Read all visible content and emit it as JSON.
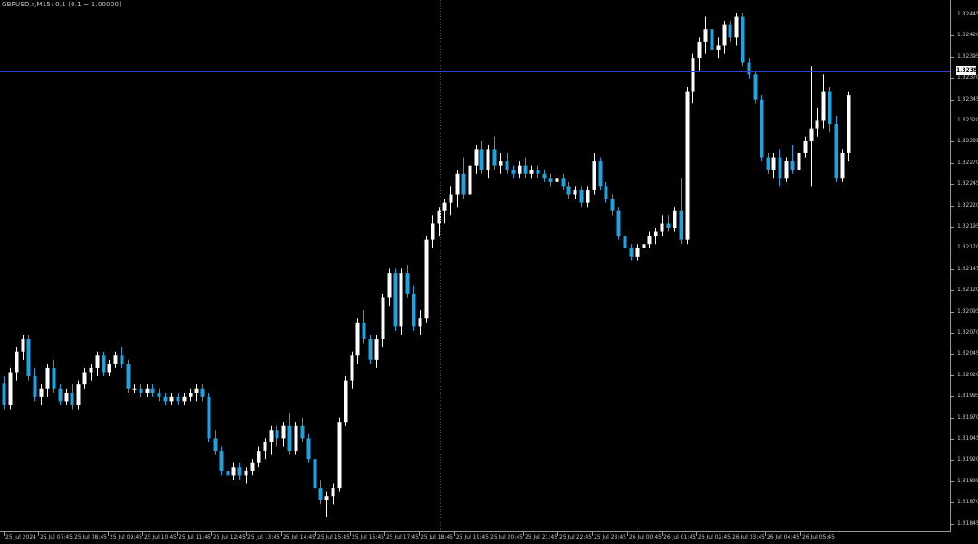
{
  "header": {
    "symbol_label": "GBPUSD.r,M15: 0.1 (0.1 ~ 1.00000)"
  },
  "price_axis": {
    "labels": [
      "1.32445",
      "1.32420",
      "1.32395",
      "1.32370",
      "1.32345",
      "1.32320",
      "1.32295",
      "1.32270",
      "1.32245",
      "1.32220",
      "1.32195",
      "1.32170",
      "1.32145",
      "1.32120",
      "1.32095",
      "1.32070",
      "1.32045",
      "1.32020",
      "1.31995",
      "1.31970",
      "1.31945",
      "1.31920",
      "1.31895",
      "1.31870",
      "1.31845"
    ],
    "current_price": "1.32380"
  },
  "time_axis": {
    "labels": [
      "25 Jul 2024",
      "25 Jul 07:45",
      "25 Jul 08:45",
      "25 Jul 09:45",
      "25 Jul 10:45",
      "25 Jul 11:45",
      "25 Jul 12:45",
      "25 Jul 13:45",
      "25 Jul 14:45",
      "25 Jul 15:45",
      "25 Jul 16:45",
      "25 Jul 17:45",
      "25 Jul 18:45",
      "25 Jul 19:45",
      "25 Jul 20:45",
      "25 Jul 21:45",
      "25 Jul 22:45",
      "25 Jul 23:45",
      "26 Jul 00:45",
      "26 Jul 01:45",
      "26 Jul 02:45",
      "26 Jul 03:45",
      "26 Jul 04:45",
      "26 Jul 05:45"
    ]
  },
  "colors": {
    "background": "#000000",
    "bull": "#ffffff",
    "bear": "#1fa3e0",
    "crosshair": "#2b3fcf",
    "axis": "#9a9a9a",
    "text": "#c8c8c8"
  },
  "chart_data": {
    "type": "candlestick",
    "title": "GBPUSD.r,M15",
    "ylim": [
      1.3184,
      1.3245
    ],
    "crosshair_price": 1.3238,
    "candles": [
      [
        1.32002,
        1.3201,
        1.3197,
        1.31975
      ],
      [
        1.31975,
        1.3202,
        1.3197,
        1.32015
      ],
      [
        1.32015,
        1.32045,
        1.32005,
        1.3204
      ],
      [
        1.3204,
        1.3206,
        1.3203,
        1.32055
      ],
      [
        1.32055,
        1.3206,
        1.32005,
        1.3201
      ],
      [
        1.3201,
        1.3202,
        1.3198,
        1.31985
      ],
      [
        1.31985,
        1.32,
        1.31975,
        1.31995
      ],
      [
        1.31995,
        1.32025,
        1.31985,
        1.3202
      ],
      [
        1.3202,
        1.3203,
        1.3199,
        1.31995
      ],
      [
        1.31995,
        1.32,
        1.31975,
        1.3198
      ],
      [
        1.3198,
        1.31995,
        1.31975,
        1.3199
      ],
      [
        1.3199,
        1.32,
        1.3197,
        1.31975
      ],
      [
        1.31975,
        1.32005,
        1.3197,
        1.32
      ],
      [
        1.32,
        1.3202,
        1.31995,
        1.32015
      ],
      [
        1.32015,
        1.32025,
        1.32005,
        1.3202
      ],
      [
        1.3202,
        1.3204,
        1.3201,
        1.32035
      ],
      [
        1.32035,
        1.3204,
        1.3201,
        1.32015
      ],
      [
        1.32015,
        1.3203,
        1.3201,
        1.32025
      ],
      [
        1.32025,
        1.3204,
        1.3202,
        1.32035
      ],
      [
        1.32035,
        1.32045,
        1.3202,
        1.32025
      ],
      [
        1.32025,
        1.3203,
        1.3199,
        1.31995
      ],
      [
        1.31995,
        1.32,
        1.3199,
        1.31995
      ],
      [
        1.31995,
        1.32,
        1.31985,
        1.3199
      ],
      [
        1.3199,
        1.32,
        1.31985,
        1.31995
      ],
      [
        1.31995,
        1.32,
        1.31985,
        1.3199
      ],
      [
        1.3199,
        1.31995,
        1.3198,
        1.31985
      ],
      [
        1.31985,
        1.3199,
        1.31975,
        1.3198
      ],
      [
        1.3198,
        1.3199,
        1.31975,
        1.31985
      ],
      [
        1.31985,
        1.3199,
        1.31975,
        1.3198
      ],
      [
        1.3198,
        1.3199,
        1.31975,
        1.31985
      ],
      [
        1.31985,
        1.31995,
        1.3198,
        1.3199
      ],
      [
        1.3199,
        1.32,
        1.3198,
        1.31995
      ],
      [
        1.31995,
        1.32,
        1.3198,
        1.31985
      ],
      [
        1.31985,
        1.3199,
        1.3193,
        1.31935
      ],
      [
        1.31935,
        1.31945,
        1.31915,
        1.3192
      ],
      [
        1.3192,
        1.31925,
        1.3189,
        1.31895
      ],
      [
        1.31895,
        1.31905,
        1.31885,
        1.3189
      ],
      [
        1.3189,
        1.31905,
        1.31885,
        1.319
      ],
      [
        1.319,
        1.31905,
        1.31885,
        1.3189
      ],
      [
        1.3189,
        1.319,
        1.3188,
        1.31895
      ],
      [
        1.31895,
        1.3191,
        1.3189,
        1.31905
      ],
      [
        1.31905,
        1.31925,
        1.319,
        1.3192
      ],
      [
        1.3192,
        1.31935,
        1.3191,
        1.3193
      ],
      [
        1.3193,
        1.3195,
        1.31915,
        1.31945
      ],
      [
        1.31945,
        1.3195,
        1.31925,
        1.31935
      ],
      [
        1.31935,
        1.31955,
        1.31925,
        1.3195
      ],
      [
        1.3195,
        1.31965,
        1.31915,
        1.3192
      ],
      [
        1.3192,
        1.31955,
        1.31915,
        1.3195
      ],
      [
        1.3195,
        1.3196,
        1.3193,
        1.31935
      ],
      [
        1.31935,
        1.3194,
        1.31905,
        1.3191
      ],
      [
        1.3191,
        1.31915,
        1.3187,
        1.31875
      ],
      [
        1.31875,
        1.31885,
        1.31855,
        1.3186
      ],
      [
        1.3186,
        1.3187,
        1.3184,
        1.31865
      ],
      [
        1.31865,
        1.3188,
        1.31855,
        1.31875
      ],
      [
        1.31875,
        1.3196,
        1.3187,
        1.31955
      ],
      [
        1.31955,
        1.3201,
        1.3195,
        1.32005
      ],
      [
        1.32005,
        1.3204,
        1.31995,
        1.32035
      ],
      [
        1.32035,
        1.3208,
        1.32025,
        1.32075
      ],
      [
        1.32075,
        1.3209,
        1.3205,
        1.32055
      ],
      [
        1.32055,
        1.3206,
        1.32025,
        1.3203
      ],
      [
        1.3203,
        1.3206,
        1.3202,
        1.32055
      ],
      [
        1.32055,
        1.3211,
        1.32045,
        1.32105
      ],
      [
        1.32105,
        1.3214,
        1.32095,
        1.32135
      ],
      [
        1.32135,
        1.3214,
        1.32065,
        1.3207
      ],
      [
        1.3207,
        1.3214,
        1.3206,
        1.32135
      ],
      [
        1.32135,
        1.32145,
        1.32105,
        1.3211
      ],
      [
        1.3211,
        1.3212,
        1.32065,
        1.3207
      ],
      [
        1.3207,
        1.3209,
        1.3206,
        1.3208
      ],
      [
        1.3208,
        1.3218,
        1.32075,
        1.32175
      ],
      [
        1.32175,
        1.32205,
        1.32165,
        1.32195
      ],
      [
        1.32195,
        1.32215,
        1.3218,
        1.3221
      ],
      [
        1.3221,
        1.32225,
        1.32195,
        1.3222
      ],
      [
        1.3222,
        1.3224,
        1.32205,
        1.3223
      ],
      [
        1.3223,
        1.3226,
        1.32215,
        1.32255
      ],
      [
        1.32255,
        1.32275,
        1.32225,
        1.3223
      ],
      [
        1.3223,
        1.3227,
        1.3222,
        1.32265
      ],
      [
        1.32265,
        1.3229,
        1.32255,
        1.32285
      ],
      [
        1.32285,
        1.32295,
        1.32255,
        1.3226
      ],
      [
        1.3226,
        1.3229,
        1.3225,
        1.32285
      ],
      [
        1.32285,
        1.323,
        1.3226,
        1.32265
      ],
      [
        1.32265,
        1.3228,
        1.32255,
        1.3227
      ],
      [
        1.3227,
        1.3228,
        1.32255,
        1.3226
      ],
      [
        1.3226,
        1.32265,
        1.3225,
        1.32255
      ],
      [
        1.32255,
        1.3227,
        1.3225,
        1.32265
      ],
      [
        1.32265,
        1.32275,
        1.3225,
        1.32255
      ],
      [
        1.32255,
        1.32265,
        1.3225,
        1.3226
      ],
      [
        1.3226,
        1.32265,
        1.3225,
        1.32255
      ],
      [
        1.32255,
        1.3226,
        1.32245,
        1.3225
      ],
      [
        1.3225,
        1.32255,
        1.3224,
        1.32245
      ],
      [
        1.32245,
        1.32255,
        1.3224,
        1.3225
      ],
      [
        1.3225,
        1.32255,
        1.32235,
        1.3224
      ],
      [
        1.3224,
        1.32245,
        1.32225,
        1.3223
      ],
      [
        1.3223,
        1.3224,
        1.32225,
        1.32235
      ],
      [
        1.32235,
        1.3224,
        1.32215,
        1.3222
      ],
      [
        1.3222,
        1.3224,
        1.32215,
        1.32235
      ],
      [
        1.32235,
        1.3228,
        1.3223,
        1.3227
      ],
      [
        1.3227,
        1.32275,
        1.32235,
        1.3224
      ],
      [
        1.3224,
        1.32245,
        1.3222,
        1.32225
      ],
      [
        1.32225,
        1.3223,
        1.32205,
        1.3221
      ],
      [
        1.3221,
        1.32215,
        1.32175,
        1.3218
      ],
      [
        1.3218,
        1.32185,
        1.3216,
        1.32165
      ],
      [
        1.32165,
        1.3217,
        1.3215,
        1.32155
      ],
      [
        1.32155,
        1.3217,
        1.3215,
        1.32165
      ],
      [
        1.32165,
        1.32175,
        1.3216,
        1.3217
      ],
      [
        1.3217,
        1.32185,
        1.32165,
        1.3218
      ],
      [
        1.3218,
        1.3219,
        1.3217,
        1.32185
      ],
      [
        1.32185,
        1.32205,
        1.3218,
        1.32195
      ],
      [
        1.32195,
        1.32205,
        1.32185,
        1.3219
      ],
      [
        1.3219,
        1.32215,
        1.32185,
        1.3221
      ],
      [
        1.3221,
        1.3225,
        1.3217,
        1.32175
      ],
      [
        1.32175,
        1.3236,
        1.3217,
        1.32355
      ],
      [
        1.32355,
        1.324,
        1.3234,
        1.32395
      ],
      [
        1.32395,
        1.3242,
        1.3238,
        1.32415
      ],
      [
        1.32415,
        1.32445,
        1.324,
        1.3243
      ],
      [
        1.3243,
        1.3244,
        1.324,
        1.32405
      ],
      [
        1.32405,
        1.3242,
        1.32395,
        1.3241
      ],
      [
        1.3241,
        1.3244,
        1.324,
        1.32435
      ],
      [
        1.32435,
        1.3244,
        1.32415,
        1.3242
      ],
      [
        1.3242,
        1.3245,
        1.3241,
        1.32445
      ],
      [
        1.32445,
        1.3245,
        1.32385,
        1.3239
      ],
      [
        1.3239,
        1.32395,
        1.3237,
        1.32375
      ],
      [
        1.32375,
        1.3238,
        1.3234,
        1.32345
      ],
      [
        1.32345,
        1.3235,
        1.3227,
        1.32275
      ],
      [
        1.32275,
        1.3228,
        1.32255,
        1.3226
      ],
      [
        1.3226,
        1.3228,
        1.3225,
        1.32275
      ],
      [
        1.32275,
        1.32285,
        1.3224,
        1.3225
      ],
      [
        1.3225,
        1.32275,
        1.32245,
        1.3227
      ],
      [
        1.3227,
        1.3229,
        1.32255,
        1.3226
      ],
      [
        1.3226,
        1.32285,
        1.32255,
        1.3228
      ],
      [
        1.3228,
        1.323,
        1.32275,
        1.32295
      ],
      [
        1.32295,
        1.32385,
        1.3224,
        1.3231
      ],
      [
        1.3231,
        1.32335,
        1.323,
        1.3232
      ],
      [
        1.3232,
        1.32375,
        1.3231,
        1.32355
      ],
      [
        1.32355,
        1.3236,
        1.32305,
        1.32315
      ],
      [
        1.32315,
        1.32325,
        1.32245,
        1.3225
      ],
      [
        1.3225,
        1.32285,
        1.32245,
        1.3228
      ],
      [
        1.3228,
        1.32355,
        1.3227,
        1.3235
      ]
    ]
  }
}
